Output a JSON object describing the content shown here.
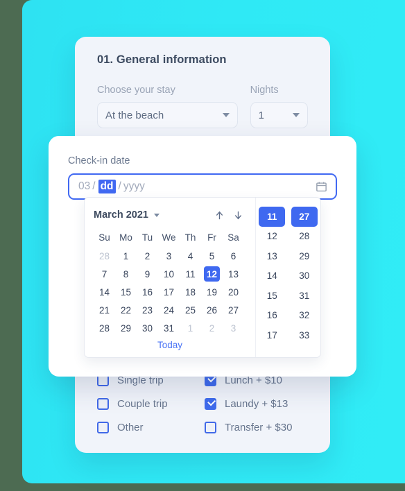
{
  "theme": {
    "backdrop_cyan": "#2fe9f5",
    "accent_blue": "#3f69f0",
    "card_bg": "#f1f4fa",
    "outer_bg": "#4d6b52"
  },
  "form": {
    "section_title": "01. General information",
    "fields": [
      {
        "label": "Choose your stay",
        "value": "At the beach"
      },
      {
        "label": "Nights",
        "value": "1"
      }
    ],
    "checkbox_columns": [
      {
        "items": [
          {
            "label": "Single trip",
            "checked": false
          },
          {
            "label": "Couple trip",
            "checked": false
          },
          {
            "label": "Other",
            "checked": false
          }
        ]
      },
      {
        "items": [
          {
            "label": "Lunch + $10",
            "checked": true
          },
          {
            "label": "Laundy + $13",
            "checked": true
          },
          {
            "label": "Transfer + $30",
            "checked": false
          }
        ]
      }
    ]
  },
  "datepicker": {
    "input_label": "Check-in date",
    "input": {
      "month_segment": "03",
      "day_segment": "dd",
      "year_segment": "yyyy",
      "separator": "/",
      "active_segment": "day",
      "icon": "calendar-icon"
    },
    "calendar": {
      "month_year": "March 2021",
      "month_caret_icon": "chevron-down-icon",
      "prev_icon": "arrow-up-icon",
      "next_icon": "arrow-down-icon",
      "weekday_headers": [
        "Su",
        "Mo",
        "Tu",
        "We",
        "Th",
        "Fr",
        "Sa"
      ],
      "weeks": [
        [
          {
            "day": "28",
            "muted": true
          },
          {
            "day": "1"
          },
          {
            "day": "2"
          },
          {
            "day": "3"
          },
          {
            "day": "4"
          },
          {
            "day": "5"
          },
          {
            "day": "6"
          }
        ],
        [
          {
            "day": "7"
          },
          {
            "day": "8"
          },
          {
            "day": "9"
          },
          {
            "day": "10"
          },
          {
            "day": "11"
          },
          {
            "day": "12",
            "selected": true
          },
          {
            "day": "13"
          }
        ],
        [
          {
            "day": "14"
          },
          {
            "day": "15"
          },
          {
            "day": "16"
          },
          {
            "day": "17"
          },
          {
            "day": "18"
          },
          {
            "day": "19"
          },
          {
            "day": "20"
          }
        ],
        [
          {
            "day": "21"
          },
          {
            "day": "22"
          },
          {
            "day": "23"
          },
          {
            "day": "24"
          },
          {
            "day": "25"
          },
          {
            "day": "26"
          },
          {
            "day": "27"
          }
        ],
        [
          {
            "day": "28"
          },
          {
            "day": "29"
          },
          {
            "day": "30"
          },
          {
            "day": "31"
          },
          {
            "day": "1",
            "muted": true
          },
          {
            "day": "2",
            "muted": true
          },
          {
            "day": "3",
            "muted": true
          }
        ]
      ],
      "today_label": "Today",
      "selected_day": "12"
    },
    "time": {
      "hours": [
        {
          "value": "11",
          "selected": true
        },
        {
          "value": "12"
        },
        {
          "value": "13"
        },
        {
          "value": "14"
        },
        {
          "value": "15"
        },
        {
          "value": "16"
        },
        {
          "value": "17"
        }
      ],
      "minutes": [
        {
          "value": "27",
          "selected": true
        },
        {
          "value": "28"
        },
        {
          "value": "29"
        },
        {
          "value": "30"
        },
        {
          "value": "31"
        },
        {
          "value": "32"
        },
        {
          "value": "33"
        }
      ],
      "selected_hour": "11",
      "selected_minute": "27"
    }
  }
}
